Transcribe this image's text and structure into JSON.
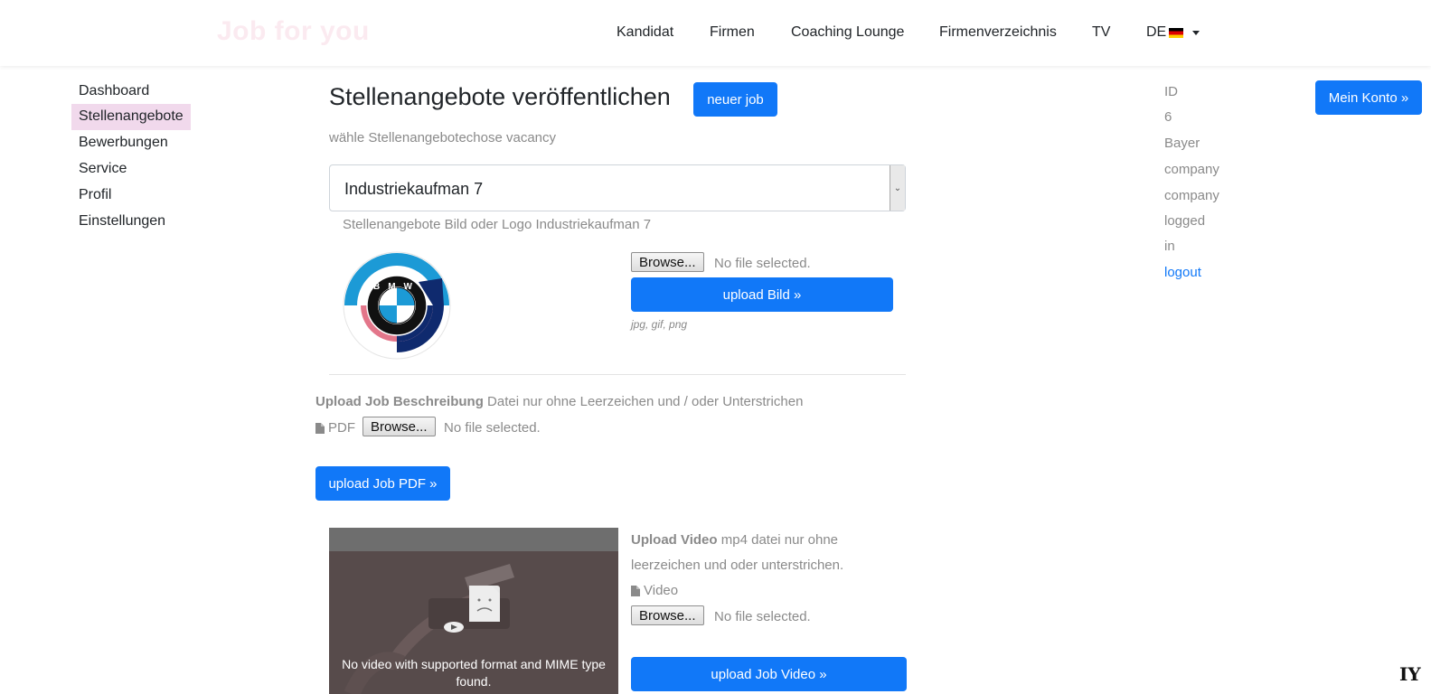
{
  "brand": "Job for you",
  "nav": {
    "items": [
      "Kandidat",
      "Firmen",
      "Coaching Lounge",
      "Firmenverzeichnis",
      "TV"
    ],
    "language": "DE"
  },
  "sidebar": {
    "items": [
      "Dashboard",
      "Stellenangebote",
      "Bewerbungen",
      "Service",
      "Profil",
      "Einstellungen"
    ],
    "active": "Stellenangebote"
  },
  "main": {
    "title": "Stellenangebote veröffentlichen",
    "new_job_button": "neuer job",
    "choose_label": "wähle Stellenangebotechose vacancy",
    "selected_vacancy": "Industriekaufman 7",
    "image_caption": "Stellenangebote Bild oder Logo Industriekaufman 7",
    "logo_letters": "BMW",
    "image_upload": {
      "browse_label": "Browse...",
      "file_status": "No file selected.",
      "upload_button": "upload Bild »",
      "hint": "jpg, gif, png"
    },
    "pdf_upload": {
      "title_bold": "Upload Job Beschreibung",
      "title_rest": "Datei nur ohne Leerzeichen und / oder Unterstrichen",
      "file_label": "PDF",
      "browse_label": "Browse...",
      "file_status": "No file selected.",
      "upload_button": "upload Job PDF »"
    },
    "video_upload": {
      "title_bold": "Upload Video",
      "title_rest_line1": "mp4 datei nur ohne",
      "title_rest_line2": "leerzeichen und oder unterstrichen.",
      "file_label": "Video",
      "browse_label": "Browse...",
      "file_status": "No file selected.",
      "upload_button": "upload Job Video »",
      "player_message": "No video with supported format and MIME type found."
    }
  },
  "account": {
    "button": "Mein Konto »",
    "info": [
      "ID",
      "6",
      "Bayer",
      "company",
      "company",
      "logged",
      "in"
    ],
    "logout": "logout"
  },
  "corner_mark": "IY",
  "colors": {
    "primary": "#1178f8",
    "sidebar_active_bg": "#f1d9ec",
    "muted_text": "#8a8a8a",
    "bmw_blue": "#1c9ad6",
    "bmw_navy": "#0f2a6e",
    "bmw_red": "#e3768a"
  }
}
